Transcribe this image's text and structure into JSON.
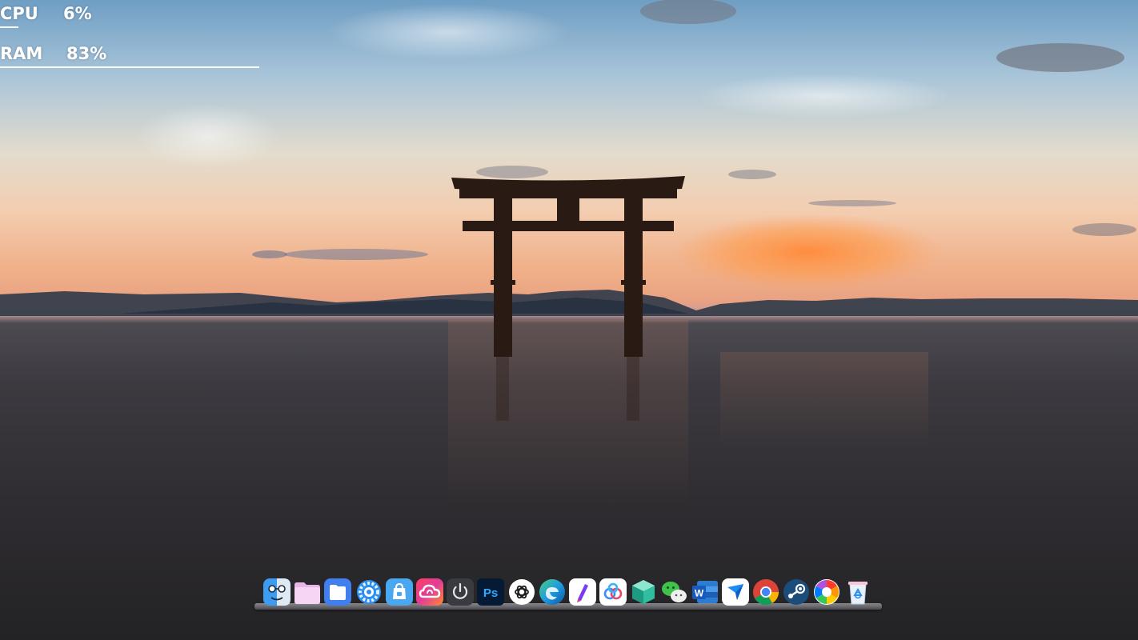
{
  "monitor": {
    "cpu": {
      "label": "CPU",
      "value": "6%",
      "percent": 6
    },
    "ram": {
      "label": "RAM",
      "value": "83%",
      "percent": 83
    }
  },
  "dock": {
    "items": [
      {
        "icon": "finder-icon"
      },
      {
        "icon": "folder-icon"
      },
      {
        "icon": "files-icon"
      },
      {
        "icon": "settings-gear-icon"
      },
      {
        "icon": "app-store-icon"
      },
      {
        "icon": "creative-cloud-icon"
      },
      {
        "icon": "power-icon"
      },
      {
        "icon": "photoshop-icon",
        "text": "Ps"
      },
      {
        "icon": "chatgpt-icon"
      },
      {
        "icon": "edge-icon"
      },
      {
        "icon": "notes-app-icon"
      },
      {
        "icon": "cloud-drive-icon"
      },
      {
        "icon": "cube-icon"
      },
      {
        "icon": "wechat-icon"
      },
      {
        "icon": "word-icon",
        "text": "W"
      },
      {
        "icon": "mail-app-icon"
      },
      {
        "icon": "chrome-icon"
      },
      {
        "icon": "steam-icon"
      },
      {
        "icon": "color-wheel-icon"
      },
      {
        "icon": "recycle-bin-icon"
      }
    ]
  }
}
